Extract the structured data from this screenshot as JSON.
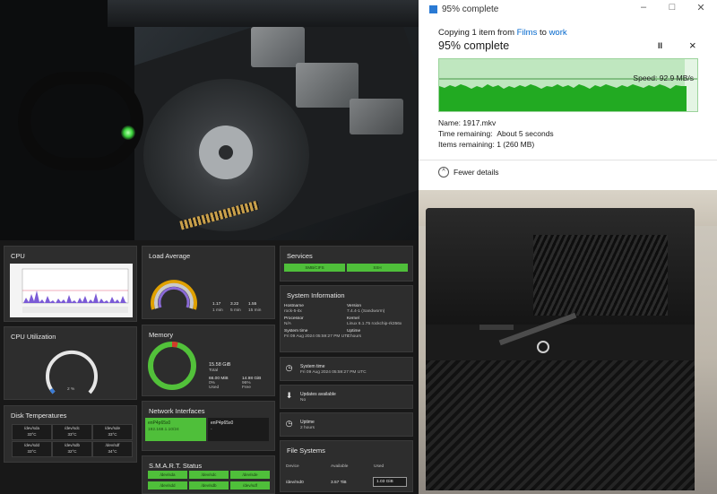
{
  "dialog": {
    "window_title": "95% complete",
    "copying_prefix": "Copying 1 item from ",
    "source": "Films",
    "to_word": " to ",
    "destination": "work",
    "heading": "95% complete",
    "pause_label": "II",
    "close_label": "×",
    "speed": "Speed: 92.9 MB/s",
    "name": "Name: 1917.mkv",
    "time_remaining_label": "Time remaining:",
    "time_remaining_value": "About 5 seconds",
    "items_remaining_label": "Items remaining:",
    "items_remaining_value": "1 (260 MB)",
    "fewer_details": "Fewer details",
    "progress_fraction": 0.95
  },
  "dashboard": {
    "cpu": {
      "title": "CPU"
    },
    "cpu_util": {
      "title": "CPU Utilization",
      "value": "2 %"
    },
    "disk_temps": {
      "title": "Disk Temperatures",
      "disks": [
        {
          "name": "/dev/sda",
          "temp": "33°C"
        },
        {
          "name": "/dev/sdc",
          "temp": "33°C"
        },
        {
          "name": "/dev/sde",
          "temp": "33°C"
        },
        {
          "name": "/dev/sdd",
          "temp": "33°C"
        },
        {
          "name": "/dev/sdb",
          "temp": "32°C"
        },
        {
          "name": "/dev/sdf",
          "temp": "34°C"
        }
      ]
    },
    "load_avg": {
      "title": "Load Average",
      "values": [
        {
          "v": "1.17",
          "l": "1 min"
        },
        {
          "v": "3.22",
          "l": "5 min"
        },
        {
          "v": "1.55",
          "l": "15 min"
        }
      ]
    },
    "memory": {
      "title": "Memory",
      "total": "15.58 GiB",
      "total_label": "Total",
      "used": "66.00 MiB",
      "used_pct": "0%",
      "used_label": "Used",
      "free": "14.98 GiB",
      "free_pct": "96%",
      "free_label": "Free",
      "used_fraction": 0.04
    },
    "network": {
      "title": "Network Interfaces",
      "if1_name": "enP4p65s0",
      "if1_detail": "192.168.1.10/24",
      "if2_name": "enP4p65s0",
      "if2_detail": "-"
    },
    "smart": {
      "title": "S.M.A.R.T. Status",
      "disks": [
        "/dev/sda",
        "/dev/sdc",
        "/dev/sde",
        "/dev/sdd",
        "/dev/sdb",
        "/dev/sdf"
      ]
    },
    "services": {
      "title": "Services",
      "items": [
        "SMB/CIFS",
        "SSH"
      ]
    },
    "sysinfo": {
      "title": "System Information",
      "hostname_label": "Hostname",
      "hostname": "rock-5-itx",
      "version_label": "Version",
      "version": "7.4.4-1 (Sandworm)",
      "processor_label": "Processor",
      "processor": "N/A",
      "kernel_label": "Kernel",
      "kernel": "Linux 6.1.75 rockchip-rk356x",
      "systime_label": "System time",
      "systime": "Fri 09 Aug 2024 05:59:27 PM UTC",
      "uptime_label": "Uptime",
      "uptime": "2 hours"
    },
    "systime_card": {
      "title": "System time",
      "value": "Fri 09 Aug 2024 05:59:27 PM UTC"
    },
    "updates_card": {
      "title": "Updates available",
      "value": "No"
    },
    "uptime_card": {
      "title": "Uptime",
      "value": "2 hours"
    },
    "fs": {
      "title": "File Systems",
      "col_device": "Device",
      "col_available": "Available",
      "col_used": "Used",
      "device": "/dev/md0",
      "available": "3.57 TiB",
      "used": "1.03 GiB"
    }
  },
  "colors": {
    "accent_green": "#4fbf3a",
    "card_bg": "#2d2d2d",
    "memory_used": "#d23b2a"
  }
}
